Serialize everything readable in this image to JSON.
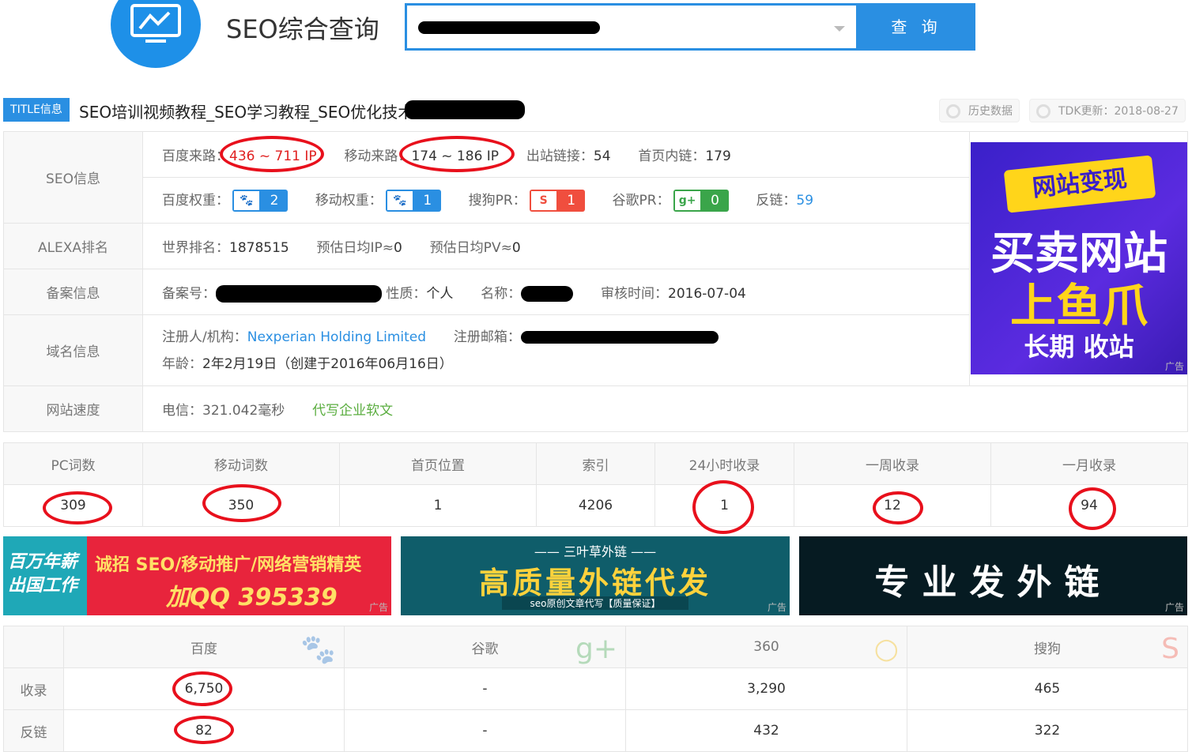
{
  "header": {
    "title": "SEO综合查询",
    "search_value": "",
    "search_button": "查 询"
  },
  "title_info": {
    "badge": "TITLE信息",
    "text": "SEO培训视频教程_SEO学习教程_SEO优化技术",
    "history": "历史数据",
    "tdk": "TDK更新：2018-08-27"
  },
  "seo": {
    "label": "SEO信息",
    "baidu_source_label": "百度来路：",
    "baidu_source": "436 ~ 711 IP",
    "mobile_source_label": "移动来路：",
    "mobile_source": "174 ~ 186 IP",
    "outlinks_label": "出站链接：",
    "outlinks": "54",
    "innerlinks_label": "首页内链：",
    "innerlinks": "179",
    "baidu_weight_label": "百度权重：",
    "baidu_weight": "2",
    "mobile_weight_label": "移动权重：",
    "mobile_weight": "1",
    "sogou_pr_label": "搜狗PR：",
    "sogou_pr": "1",
    "google_pr_label": "谷歌PR：",
    "google_pr": "0",
    "backlinks_label": "反链：",
    "backlinks": "59"
  },
  "alexa": {
    "label": "ALEXA排名",
    "world_rank_label": "世界排名：",
    "world_rank": "1878515",
    "ip_label": "预估日均IP≈",
    "ip": "0",
    "pv_label": "预估日均PV≈",
    "pv": "0"
  },
  "icp": {
    "label": "备案信息",
    "no_label": "备案号：",
    "type_label": "性质：",
    "type": "个人",
    "name_label": "名称：",
    "audit_label": "审核时间：",
    "audit": "2016-07-04"
  },
  "domain": {
    "label": "域名信息",
    "registrant_label": "注册人/机构：",
    "registrant": "Nexperian Holding Limited",
    "email_label": "注册邮箱：",
    "age_label": "年龄：",
    "age": "2年2月19日（创建于2016年06月16日）"
  },
  "speed": {
    "label": "网站速度",
    "telecom": "电信：321.042毫秒",
    "link": "代写企业软文"
  },
  "side_ad": {
    "line1": "网站变现",
    "line2": "买卖网站",
    "line3": "上鱼爪",
    "line4": "长期  收站",
    "tag": "广告"
  },
  "stats": {
    "headers": [
      "PC词数",
      "移动词数",
      "首页位置",
      "索引",
      "24小时收录",
      "一周收录",
      "一月收录"
    ],
    "values": [
      "309",
      "350",
      "1",
      "4206",
      "1",
      "12",
      "94"
    ]
  },
  "banners": {
    "b1_left": "百万年薪 出国工作",
    "b1_line1": "诚招 SEO/移动推广/网络营销精英",
    "b1_line2": "加QQ 395339",
    "b2_top": "—— 三叶草外链 ——",
    "b2_main": "高质量外链代发",
    "b2_sub": "seo原创文章代写【质量保证】",
    "b3_main": "专业发外链",
    "tag": "广告"
  },
  "engines": {
    "headers": [
      "百度",
      "谷歌",
      "360",
      "搜狗"
    ],
    "rows": [
      {
        "label": "收录",
        "values": [
          "6,750",
          "-",
          "3,290",
          "465"
        ]
      },
      {
        "label": "反链",
        "values": [
          "82",
          "-",
          "432",
          "322"
        ]
      }
    ]
  },
  "colors": {
    "accent": "#2a8fe2",
    "highlight": "#e8101c",
    "link_green": "#5aad3f"
  }
}
